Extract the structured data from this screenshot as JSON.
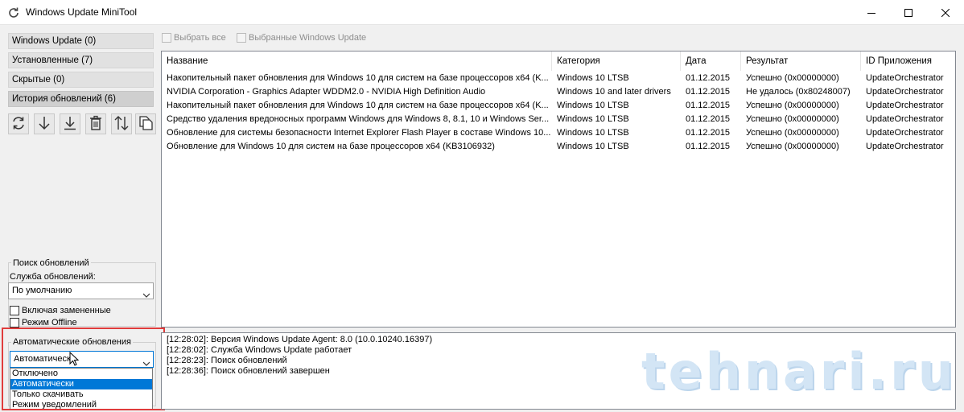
{
  "window": {
    "title": "Windows Update MiniTool"
  },
  "toolbar": {
    "select_all": "Выбрать все",
    "selected_updates": "Выбранные Windows Update"
  },
  "sidebar": {
    "buttons": [
      {
        "label": "Windows Update (0)"
      },
      {
        "label": "Установленные (7)"
      },
      {
        "label": "Скрытые (0)"
      },
      {
        "label": "История обновлений (6)"
      }
    ],
    "tools": [
      {
        "icon": "refresh-icon"
      },
      {
        "icon": "download-icon"
      },
      {
        "icon": "install-icon"
      },
      {
        "icon": "trash-icon"
      },
      {
        "icon": "sort-icon"
      },
      {
        "icon": "copy-icon"
      }
    ]
  },
  "search_group": {
    "title": "Поиск обновлений",
    "service_label": "Служба обновлений:",
    "service_value": "По умолчанию",
    "include_replaced": "Включая замененные",
    "offline_mode": "Режим Offline"
  },
  "auto_group": {
    "title": "Автоматические обновления",
    "value": "Автоматически",
    "options": [
      "Отключено",
      "Автоматически",
      "Только скачивать",
      "Режим уведомлений"
    ],
    "selected_index": 1
  },
  "table": {
    "columns": [
      "Название",
      "Категория",
      "Дата",
      "Результат",
      "ID Приложения"
    ],
    "rows": [
      [
        "Накопительный пакет обновления для Windows 10 для систем на базе процессоров x64 (K...",
        "Windows 10 LTSB",
        "01.12.2015",
        "Успешно (0x00000000)",
        "UpdateOrchestrator"
      ],
      [
        "NVIDIA Corporation - Graphics Adapter WDDM2.0 - NVIDIA High Definition Audio",
        "Windows 10 and later drivers",
        "01.12.2015",
        "Не удалось (0x80248007)",
        "UpdateOrchestrator"
      ],
      [
        "Накопительный пакет обновления для Windows 10 для систем на базе процессоров x64 (K...",
        "Windows 10 LTSB",
        "01.12.2015",
        "Успешно (0x00000000)",
        "UpdateOrchestrator"
      ],
      [
        "Средство удаления вредоносных программ Windows для Windows 8, 8.1, 10 и Windows Ser...",
        "Windows 10 LTSB",
        "01.12.2015",
        "Успешно (0x00000000)",
        "UpdateOrchestrator"
      ],
      [
        "Обновление для системы безопасности Internet Explorer Flash Player в составе Windows 10...",
        "Windows 10 LTSB",
        "01.12.2015",
        "Успешно (0x00000000)",
        "UpdateOrchestrator"
      ],
      [
        "Обновление для Windows 10 для систем на базе процессоров x64 (KB3106932)",
        "Windows 10 LTSB",
        "01.12.2015",
        "Успешно (0x00000000)",
        "UpdateOrchestrator"
      ]
    ]
  },
  "log": {
    "lines": [
      "[12:28:02]: Версия Windows Update Agent: 8.0 (10.0.10240.16397)",
      "[12:28:02]: Служба Windows Update работает",
      "[12:28:23]: Поиск обновлений",
      "[12:28:36]: Поиск обновлений завершен"
    ]
  },
  "watermark": "tehnari.ru"
}
